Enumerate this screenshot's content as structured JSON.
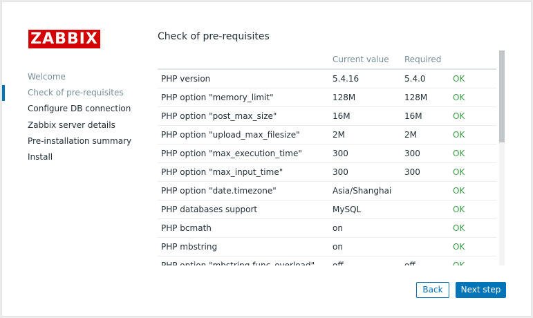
{
  "logo": {
    "text": "ZABBIX"
  },
  "nav": {
    "items": [
      {
        "label": "Welcome",
        "state": "done"
      },
      {
        "label": "Check of pre-requisites",
        "state": "current"
      },
      {
        "label": "Configure DB connection",
        "state": "pending"
      },
      {
        "label": "Zabbix server details",
        "state": "pending"
      },
      {
        "label": "Pre-installation summary",
        "state": "pending"
      },
      {
        "label": "Install",
        "state": "pending"
      }
    ]
  },
  "page": {
    "title": "Check of pre-requisites"
  },
  "table": {
    "headers": [
      "",
      "Current value",
      "Required",
      ""
    ],
    "rows": [
      {
        "name": "PHP version",
        "current": "5.4.16",
        "required": "5.4.0",
        "status": "OK"
      },
      {
        "name": "PHP option \"memory_limit\"",
        "current": "128M",
        "required": "128M",
        "status": "OK"
      },
      {
        "name": "PHP option \"post_max_size\"",
        "current": "16M",
        "required": "16M",
        "status": "OK"
      },
      {
        "name": "PHP option \"upload_max_filesize\"",
        "current": "2M",
        "required": "2M",
        "status": "OK"
      },
      {
        "name": "PHP option \"max_execution_time\"",
        "current": "300",
        "required": "300",
        "status": "OK"
      },
      {
        "name": "PHP option \"max_input_time\"",
        "current": "300",
        "required": "300",
        "status": "OK"
      },
      {
        "name": "PHP option \"date.timezone\"",
        "current": "Asia/Shanghai",
        "required": "",
        "status": "OK"
      },
      {
        "name": "PHP databases support",
        "current": "MySQL",
        "required": "",
        "status": "OK"
      },
      {
        "name": "PHP bcmath",
        "current": "on",
        "required": "",
        "status": "OK"
      },
      {
        "name": "PHP mbstring",
        "current": "on",
        "required": "",
        "status": "OK"
      },
      {
        "name": "PHP option \"mbstring.func_overload\"",
        "current": "off",
        "required": "off",
        "status": "OK"
      }
    ]
  },
  "buttons": {
    "back": "Back",
    "next": "Next step"
  },
  "colors": {
    "accent": "#0275b8",
    "ok": "#3a9c43",
    "logo_bg": "#d40000"
  }
}
